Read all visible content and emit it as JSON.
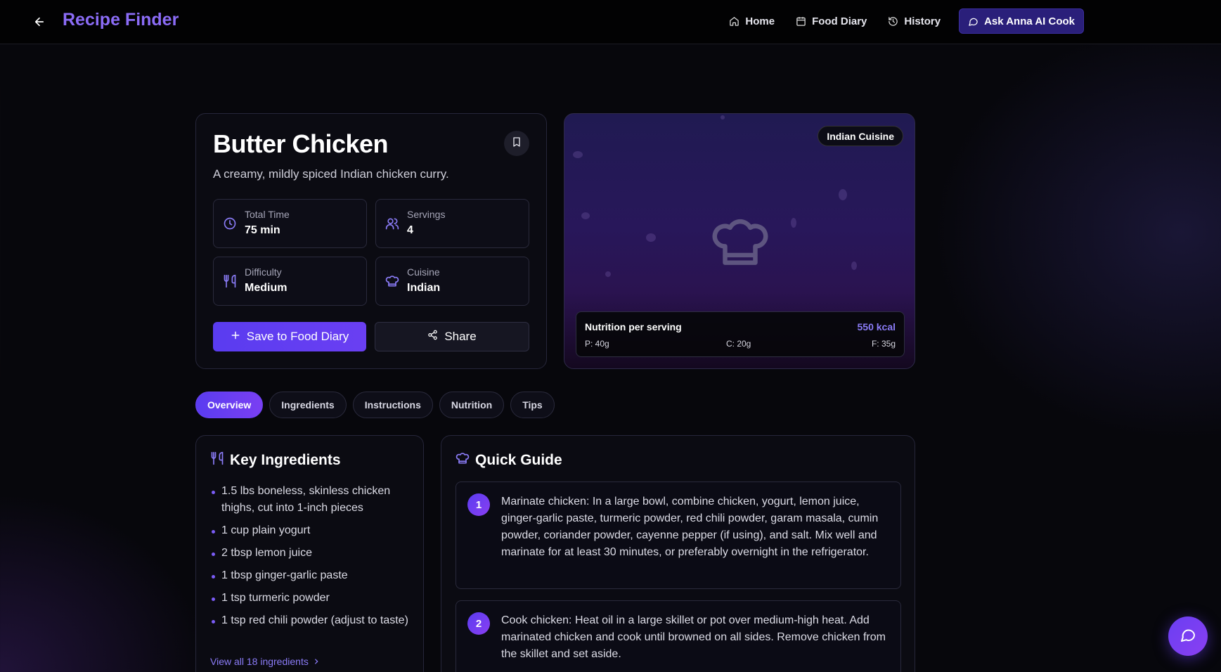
{
  "header": {
    "brand": "Recipe Finder",
    "nav": [
      {
        "label": "Home",
        "icon": "home-icon"
      },
      {
        "label": "Food Diary",
        "icon": "calendar-icon"
      },
      {
        "label": "History",
        "icon": "history-icon"
      },
      {
        "label": "Ask Anna AI Cook",
        "icon": "chat-icon"
      }
    ]
  },
  "recipe": {
    "title": "Butter Chicken",
    "description": "A creamy, mildly spiced Indian chicken curry.",
    "stats": [
      {
        "label": "Total Time",
        "value": "75 min",
        "icon": "clock-icon"
      },
      {
        "label": "Servings",
        "value": "4",
        "icon": "users-icon"
      },
      {
        "label": "Difficulty",
        "value": "Medium",
        "icon": "utensils-icon"
      },
      {
        "label": "Cuisine",
        "value": "Indian",
        "icon": "chef-hat-icon"
      }
    ],
    "save_label": "Save to Food Diary",
    "share_label": "Share"
  },
  "image_panel": {
    "badge": "Indian Cuisine",
    "nutrition_title": "Nutrition per serving",
    "kcal": "550 kcal",
    "protein": "P: 40g",
    "carbs": "C: 20g",
    "fat": "F: 35g"
  },
  "tabs": [
    "Overview",
    "Ingredients",
    "Instructions",
    "Nutrition",
    "Tips"
  ],
  "active_tab": "Overview",
  "key_ingredients": {
    "title": "Key Ingredients",
    "items": [
      "1.5 lbs boneless, skinless chicken thighs, cut into 1-inch pieces",
      "1 cup plain yogurt",
      "2 tbsp lemon juice",
      "1 tbsp ginger-garlic paste",
      "1 tsp turmeric powder",
      "1 tsp red chili powder (adjust to taste)"
    ],
    "view_all": "View all 18 ingredients"
  },
  "quick_guide": {
    "title": "Quick Guide",
    "steps": [
      {
        "num": "1",
        "text": "Marinate chicken: In a large bowl, combine chicken, yogurt, lemon juice, ginger-garlic paste, turmeric powder, red chili powder, garam masala, cumin powder, coriander powder, cayenne pepper (if using), and salt. Mix well and marinate for at least 30 minutes, or preferably overnight in the refrigerator."
      },
      {
        "num": "2",
        "text": "Cook chicken: Heat oil in a large skillet or pot over medium-high heat. Add marinated chicken and cook until browned on all sides. Remove chicken from the skillet and set aside."
      }
    ]
  },
  "colors": {
    "accent": "#6a3ff2",
    "brand": "#8b6cf6",
    "background": "#07070c"
  }
}
